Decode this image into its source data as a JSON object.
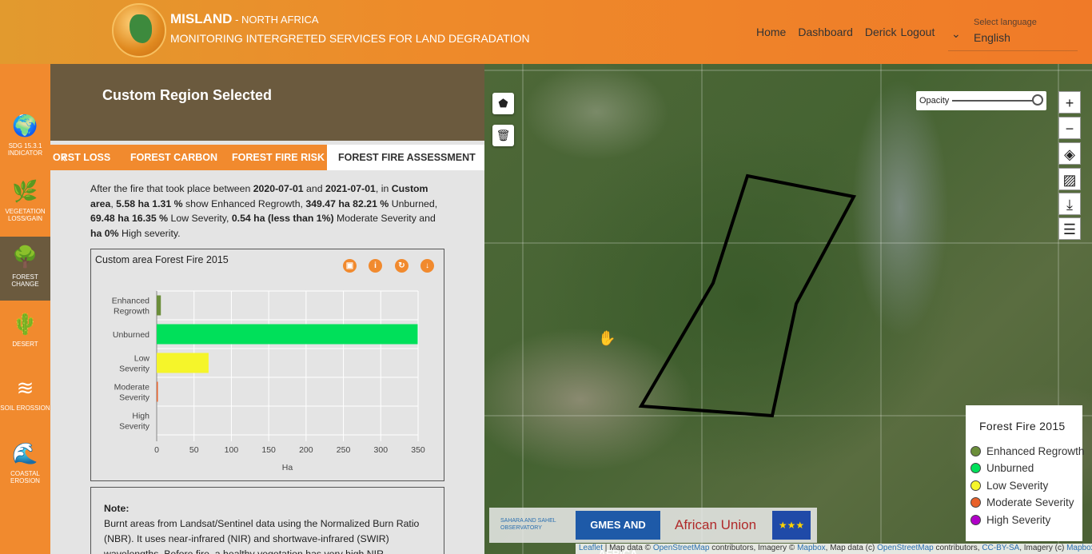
{
  "header": {
    "brand": "MISLAND",
    "brand_sub": " - NORTH AFRICA",
    "tagline": "MONITORING INTERGRETED SERVICES FOR LAND DEGRADATION",
    "nav": [
      "Home",
      "Dashboard",
      "Derick",
      "Logout"
    ],
    "language_label": "Select language",
    "language_value": "English"
  },
  "rail": [
    {
      "label": "SDG 15.3.1 INDICATOR",
      "icon": "globe-icon",
      "glyph": "🌍"
    },
    {
      "label": "VEGETATION LOSS/GAIN",
      "icon": "leaf-icon",
      "glyph": "🌿"
    },
    {
      "label": "FOREST CHANGE",
      "icon": "tree-icon",
      "glyph": "🌳"
    },
    {
      "label": "DESERT",
      "icon": "desert-icon",
      "glyph": "🌵"
    },
    {
      "label": "SOIL EROSSION",
      "icon": "soil-icon",
      "glyph": "≋"
    },
    {
      "label": "COASTAL EROSION",
      "icon": "coast-icon",
      "glyph": "🌊"
    }
  ],
  "panel": {
    "title": "Custom Region Selected",
    "tabs": [
      "ORST LOSS",
      "FOREST CARBON",
      "FOREST FIRE RISK",
      "FOREST FIRE ASSESSMENT"
    ],
    "active_tab": "FOREST FIRE ASSESSMENT",
    "summary": {
      "p1": "After the fire that took place between ",
      "date_from": "2020-07-01",
      "p2": " and ",
      "date_to": "2021-07-01",
      "p3": ", in ",
      "area": "Custom area",
      "p4": ", ",
      "enh": "5.58 ha 1.31 %",
      "p5": " show Enhanced Regrowth, ",
      "unb": "349.47 ha 82.21 %",
      "p6": " Unburned, ",
      "low": "69.48 ha 16.35 %",
      "p7": " Low Severity, ",
      "mod": "0.54 ha (less than 1%)",
      "p8": " Moderate Severity and ",
      "high": "ha 0%",
      "p9": " High severity."
    },
    "note_title": "Note:",
    "note_text": "Burnt areas from Landsat/Sentinel data using the Normalized Burn Ratio (NBR). It uses near-infrared (NIR) and shortwave-infrared (SWIR) wavelengths. Before fire, a healthy vegetation has very high NIR"
  },
  "chart_data": {
    "type": "bar",
    "orientation": "horizontal",
    "title": "Custom area Forest Fire 2015",
    "categories": [
      "Enhanced Regrowth",
      "Unburned",
      "Low Severity",
      "Moderate Severity",
      "High Severity"
    ],
    "category_lines": [
      [
        "Enhanced",
        "Regrowth"
      ],
      [
        "Unburned"
      ],
      [
        "Low",
        "Severity"
      ],
      [
        "Moderate",
        "Severity"
      ],
      [
        "High",
        "Severity"
      ]
    ],
    "values": [
      5.58,
      349.47,
      69.48,
      0.54,
      0
    ],
    "colors": [
      "#6b8e3a",
      "#00e05a",
      "#f5f52a",
      "#e8612a",
      "#b000c8"
    ],
    "xlabel": "Ha",
    "xlim": [
      0,
      350
    ],
    "xticks": [
      0,
      50,
      100,
      150,
      200,
      250,
      300,
      350
    ],
    "grid": true
  },
  "map": {
    "opacity_label": "Opacity",
    "legend_title": "Forest Fire 2015",
    "legend": [
      {
        "label": "Enhanced Regrowth",
        "color": "#6b8e3a"
      },
      {
        "label": "Unburned",
        "color": "#00e05a"
      },
      {
        "label": "Low Severity",
        "color": "#f5f52a"
      },
      {
        "label": "Moderate Severity",
        "color": "#e8612a"
      },
      {
        "label": "High Severity",
        "color": "#b000c8"
      }
    ],
    "sponsors": [
      "SAHARA AND SAHEL OBSERVATORY",
      "GMES AND AFRICA",
      "African Union",
      "EU"
    ],
    "attribution": {
      "leaflet": "Leaflet",
      "t1": " | Map data © ",
      "osm": "OpenStreetMap",
      "t2": " contributors, Imagery © ",
      "mapbox": "Mapbox",
      "t3": ", Map data (c) ",
      "osm2": "OpenStreetMap",
      "t4": " contributors, ",
      "cc": "CC-BY-SA",
      "t5": ", Imagery (c) ",
      "mapbox2": "Mapbox"
    }
  }
}
